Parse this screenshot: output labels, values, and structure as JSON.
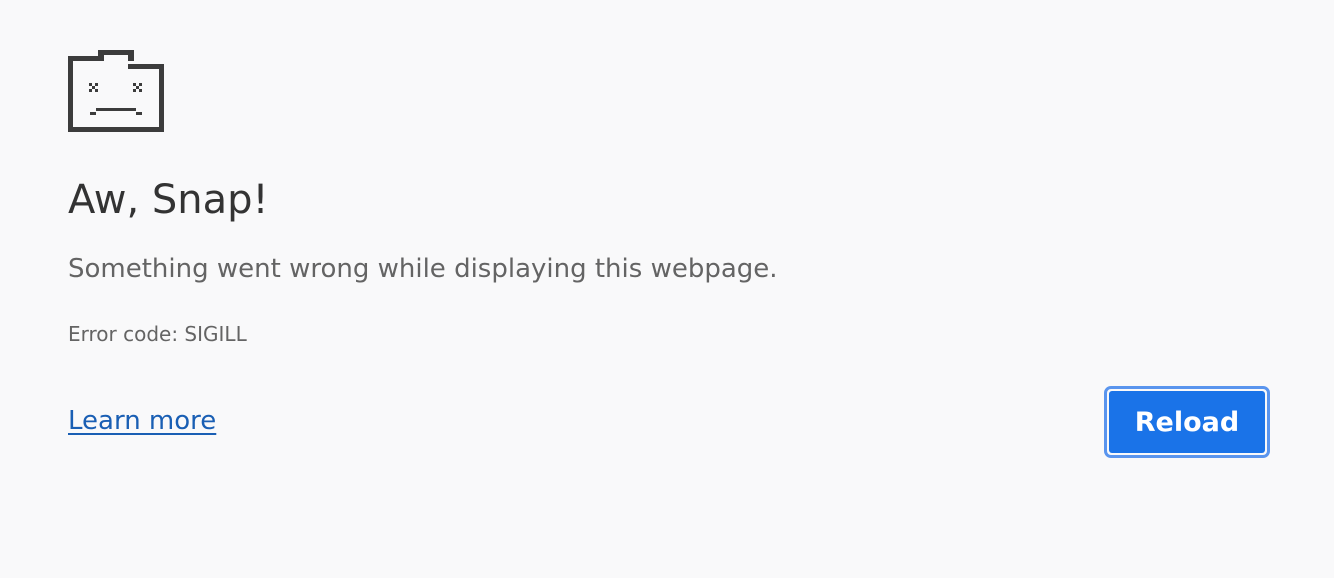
{
  "error_page": {
    "icon": "sad-tab-icon",
    "title": "Aw, Snap!",
    "message": "Something went wrong while displaying this webpage.",
    "error_code": "Error code: SIGILL",
    "learn_more_label": "Learn more",
    "reload_label": "Reload"
  },
  "colors": {
    "background": "#f9f9fa",
    "title_text": "#333333",
    "body_text": "#646464",
    "link": "#1a5fb4",
    "button_fill": "#1a73e8",
    "button_focus_ring": "#5a95ee",
    "icon": "#3c3c3c"
  }
}
